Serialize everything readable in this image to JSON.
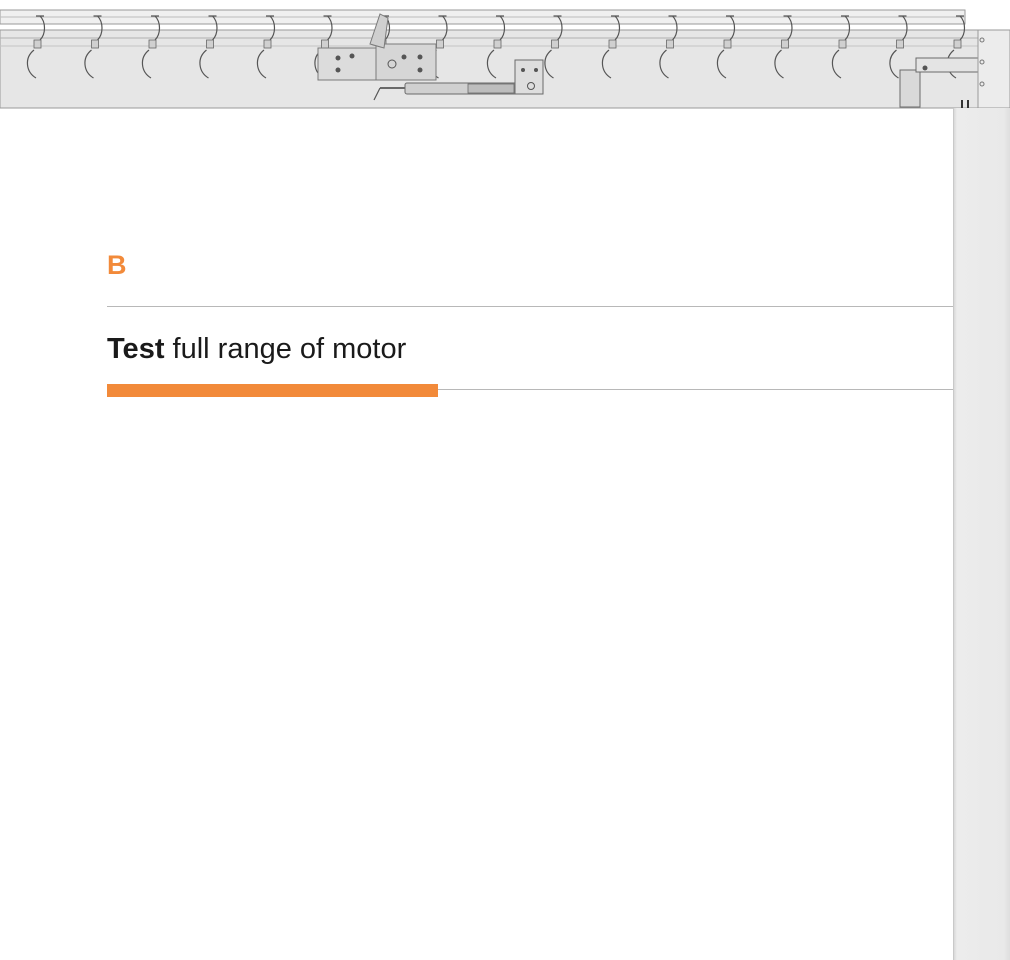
{
  "step": {
    "letter": "B",
    "title_bold": "Test",
    "title_rest": " full range of motor"
  },
  "illustration": {
    "name": "overhead curtain track with motor unit",
    "hook_count": 17
  },
  "colors": {
    "accent": "#f28a3a",
    "rule": "#b8b8b8",
    "track_fill": "#e6e6e6",
    "track_stroke": "#9a9a9a",
    "post": "#e9e9e9",
    "text": "#1a1a1a"
  }
}
